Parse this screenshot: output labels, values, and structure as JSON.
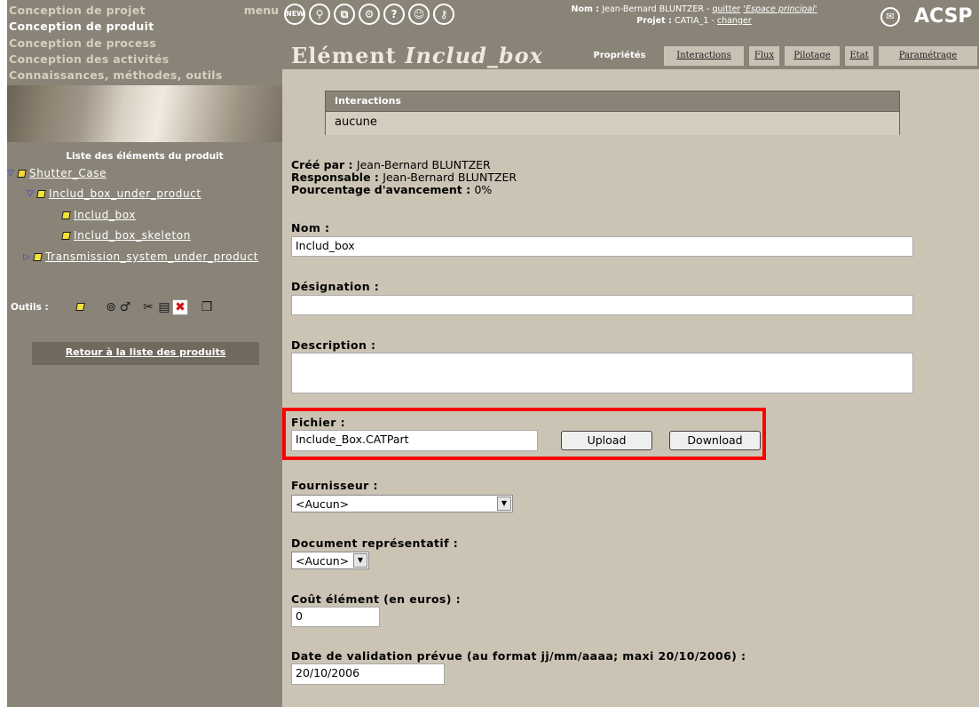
{
  "sidebar": {
    "nav": [
      {
        "label": "Conception de projet"
      },
      {
        "label": "Conception de produit"
      },
      {
        "label": "Conception de process"
      },
      {
        "label": "Conception des activités"
      },
      {
        "label": "Connaissances, méthodes, outils"
      }
    ],
    "menu_label": "menu",
    "list_title": "Liste des éléments du produit",
    "tree": [
      {
        "label": "Shutter_Case"
      },
      {
        "label": "Includ_box_under_product"
      },
      {
        "label": "Includ_box"
      },
      {
        "label": "Includ_box_skeleton"
      },
      {
        "label": "Transmission_system_under_product"
      }
    ],
    "tools_label": "Outils :",
    "back_link": "Retour à la liste des produits"
  },
  "topbar": {
    "icons": [
      "new-icon",
      "search-icon",
      "copy-icon",
      "settings-icon",
      "help-icon",
      "gear-icon",
      "key-icon"
    ],
    "new_label": "NEW",
    "user_prefix": "Nom : ",
    "user_name": "Jean-Bernard BLUNTZER",
    "quit_sep": " - ",
    "quit_label": "quitter",
    "space_label": "'Espace principal'",
    "project_prefix": "Projet : ",
    "project_name": "CATIA_1",
    "change_label": "changer",
    "brand": "ACSP"
  },
  "header": {
    "title_prefix": "Elément ",
    "title_name": "Includ_box",
    "tabs": [
      {
        "label": "Propriétés",
        "active": true
      },
      {
        "label": "Interactions"
      },
      {
        "label": "Flux"
      },
      {
        "label": "Pilotage"
      },
      {
        "label": "Etat"
      },
      {
        "label": "Paramétrage"
      }
    ]
  },
  "main": {
    "interactions_title": "Interactions",
    "interactions_value": "aucune",
    "created_by_label": "Créé par : ",
    "created_by_value": "Jean-Bernard BLUNTZER",
    "responsible_label": "Responsable : ",
    "responsible_value": "Jean-Bernard BLUNTZER",
    "progress_label": "Pourcentage d'avancement : ",
    "progress_value": "0%",
    "nom_label": "Nom :",
    "nom_value": "Includ_box",
    "designation_label": "Désignation :",
    "designation_value": "",
    "description_label": "Description :",
    "description_value": "",
    "fichier_label": "Fichier :",
    "fichier_value": "Include_Box.CATPart",
    "upload_label": "Upload",
    "download_label": "Download",
    "fournisseur_label": "Fournisseur :",
    "fournisseur_value": "<Aucun>",
    "document_label": "Document représentatif :",
    "document_value": "<Aucun>",
    "cout_label": "Coût élément (en euros) :",
    "cout_value": "0",
    "date_label": "Date de validation prévue (au format jj/mm/aaaa; maxi 20/10/2006) :",
    "date_value": "20/10/2006"
  },
  "colors": {
    "sidebar_bg": "#8a8478",
    "main_bg": "#cbc4b5",
    "highlight": "#ff0000"
  }
}
